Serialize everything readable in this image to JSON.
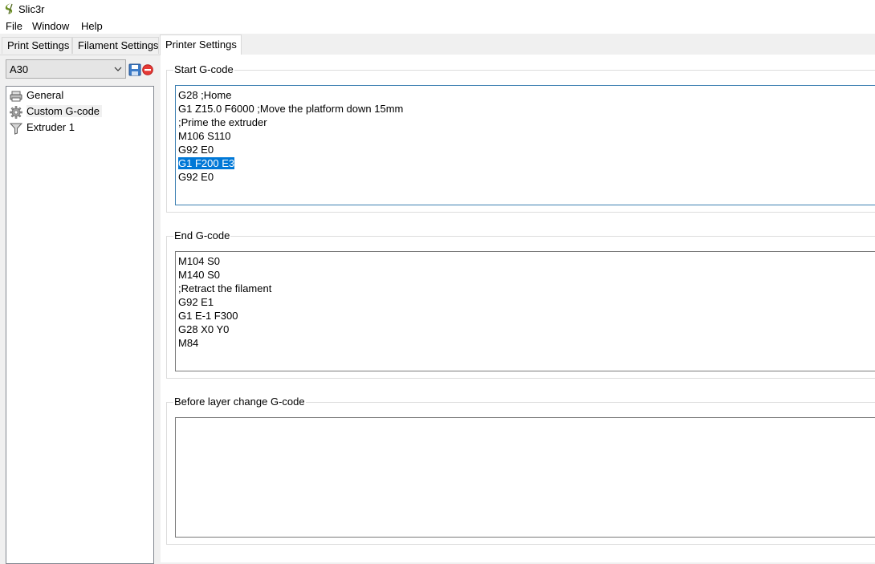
{
  "window": {
    "title": "Slic3r"
  },
  "menu": [
    "File",
    "Window",
    "Help"
  ],
  "tabs": [
    {
      "label": "Print Settings",
      "active": false
    },
    {
      "label": "Filament Settings",
      "active": false
    },
    {
      "label": "Printer Settings",
      "active": true
    }
  ],
  "preset": {
    "selected": "A30"
  },
  "tree": [
    {
      "label": "General",
      "icon": "printer-icon",
      "selected": false
    },
    {
      "label": "Custom G-code",
      "icon": "cog-icon",
      "selected": true
    },
    {
      "label": "Extruder 1",
      "icon": "funnel-icon",
      "selected": false
    }
  ],
  "sections": [
    {
      "title": "Start G-code",
      "focused": true,
      "lines": [
        {
          "text": "G28 ;Home"
        },
        {
          "text": "G1 Z15.0 F6000 ;Move the platform down 15mm"
        },
        {
          "text": ";Prime the extruder"
        },
        {
          "text": "M106 S110"
        },
        {
          "text": "G92 E0"
        },
        {
          "text": "G1 F200 E3",
          "selected": true
        },
        {
          "text": "G92 E0"
        }
      ]
    },
    {
      "title": "End G-code",
      "focused": false,
      "lines": [
        {
          "text": "M104 S0"
        },
        {
          "text": "M140 S0"
        },
        {
          "text": ";Retract the filament"
        },
        {
          "text": "G92 E1"
        },
        {
          "text": "G1 E-1 F300"
        },
        {
          "text": "G28 X0 Y0"
        },
        {
          "text": "M84"
        }
      ]
    },
    {
      "title": "Before layer change G-code",
      "focused": false,
      "lines": []
    }
  ],
  "colors": {
    "selection": "#0078d7",
    "focus_border": "#3c7fb1",
    "app_icon": "#6b8e23"
  }
}
